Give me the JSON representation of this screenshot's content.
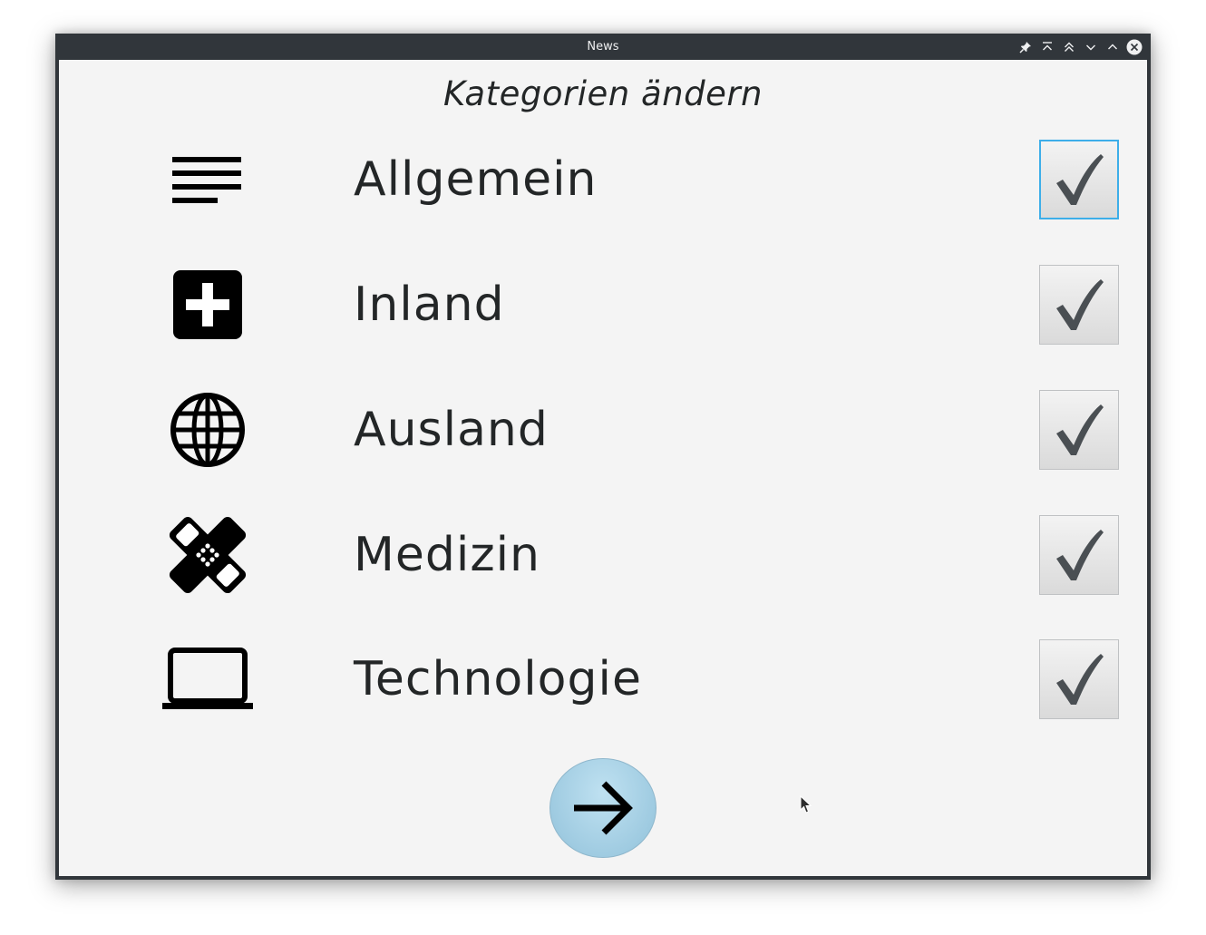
{
  "window": {
    "title": "News"
  },
  "titlebar_buttons": [
    {
      "name": "pin-icon"
    },
    {
      "name": "keep-above-icon"
    },
    {
      "name": "shade-icon"
    },
    {
      "name": "minimize-icon"
    },
    {
      "name": "maximize-icon"
    },
    {
      "name": "close-icon"
    }
  ],
  "heading": "Kategorien ändern",
  "categories": [
    {
      "label": "Allgemein",
      "icon": "text-lines-icon",
      "checked": true,
      "focused": true
    },
    {
      "label": "Inland",
      "icon": "medical-cross-icon",
      "checked": true,
      "focused": false
    },
    {
      "label": "Ausland",
      "icon": "globe-icon",
      "checked": true,
      "focused": false
    },
    {
      "label": "Medizin",
      "icon": "bandage-icon",
      "checked": true,
      "focused": false
    },
    {
      "label": "Technologie",
      "icon": "laptop-icon",
      "checked": true,
      "focused": false
    }
  ],
  "next_button": {
    "icon": "arrow-right-icon"
  },
  "colors": {
    "titlebar": "#31363b",
    "background": "#f4f4f4",
    "focus": "#3daee9",
    "button": "#a9d4e9",
    "text": "#232627"
  }
}
